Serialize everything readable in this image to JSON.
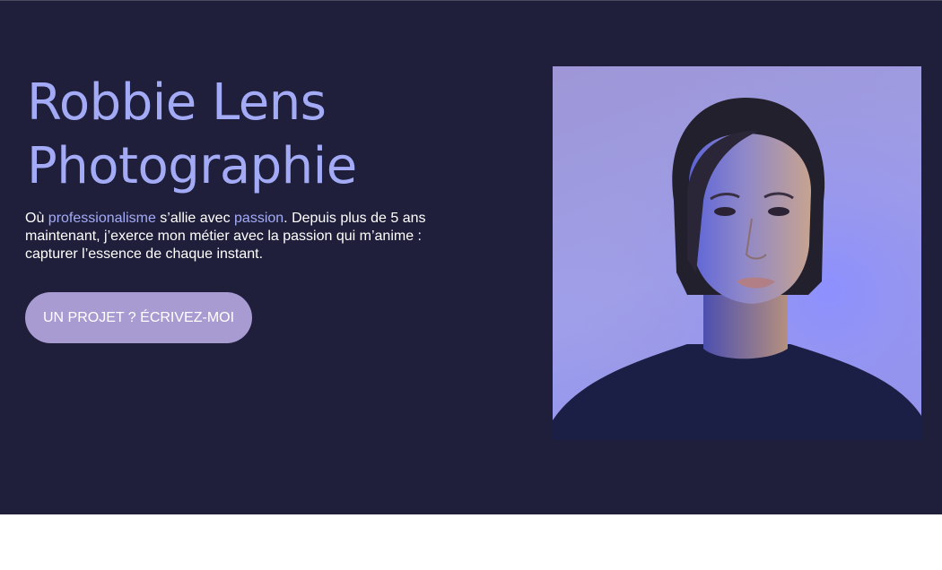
{
  "hero": {
    "title_line1": "Robbie Lens",
    "title_line2": "Photographie",
    "intro": {
      "part1": "Où ",
      "highlight1": "professionalisme",
      "part2": " s’allie avec ",
      "highlight2": "passion",
      "part3": ". Depuis plus de 5 ans maintenant, j’exerce mon métier avec la passion qui m’anime : capturer l’essence de chaque instant."
    },
    "cta_label": "UN PROJET ? ÉCRIVEZ-MOI",
    "photo_icon": "portrait-photo"
  },
  "colors": {
    "hero_bg": "#1f1f3b",
    "accent": "#a4abf6",
    "button_bg": "#a89bd2",
    "text": "#ffffff"
  }
}
